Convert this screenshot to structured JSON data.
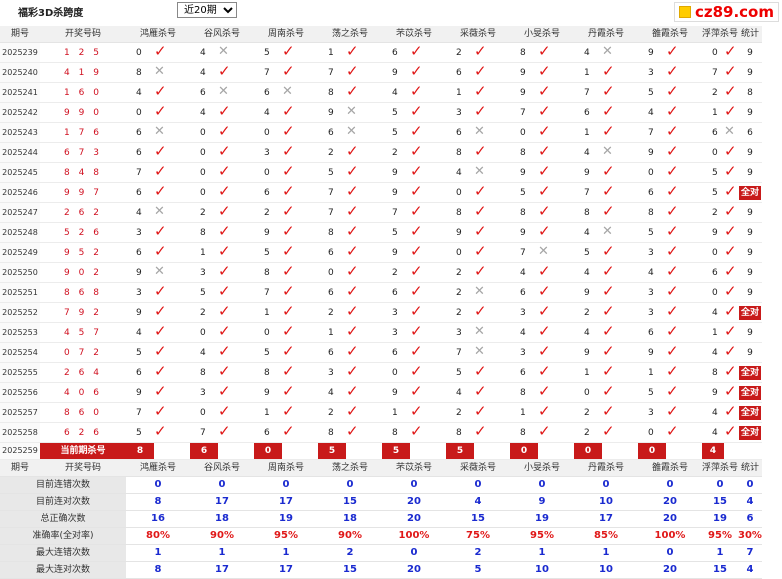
{
  "page": {
    "title": "福彩3D杀跨度",
    "period_select": "近20期",
    "logo_text": "cz89.com"
  },
  "columns": [
    "期号",
    "开奖号码",
    "鸿雁杀号",
    "谷风杀号",
    "周南杀号",
    "荡之杀号",
    "芣苡杀号",
    "采薇杀号",
    "小旻杀号",
    "丹霞杀号",
    "雒霞杀号",
    "浮萍杀号",
    "统计"
  ],
  "rows": [
    {
      "p": "2025239",
      "n": "125",
      "k": [
        [
          "0",
          1
        ],
        [
          "4",
          0
        ],
        [
          "5",
          1
        ],
        [
          "1",
          1
        ],
        [
          "6",
          1
        ],
        [
          "2",
          1
        ],
        [
          "8",
          1
        ],
        [
          "4",
          0
        ],
        [
          "9",
          1
        ],
        [
          "0",
          1
        ]
      ],
      "s": "9"
    },
    {
      "p": "2025240",
      "n": "419",
      "k": [
        [
          "8",
          0
        ],
        [
          "4",
          1
        ],
        [
          "7",
          1
        ],
        [
          "7",
          1
        ],
        [
          "9",
          1
        ],
        [
          "6",
          1
        ],
        [
          "9",
          1
        ],
        [
          "1",
          1
        ],
        [
          "3",
          1
        ],
        [
          "7",
          1
        ]
      ],
      "s": "9"
    },
    {
      "p": "2025241",
      "n": "160",
      "k": [
        [
          "4",
          1
        ],
        [
          "6",
          0
        ],
        [
          "6",
          0
        ],
        [
          "8",
          1
        ],
        [
          "4",
          1
        ],
        [
          "1",
          1
        ],
        [
          "9",
          1
        ],
        [
          "7",
          1
        ],
        [
          "5",
          1
        ],
        [
          "2",
          1
        ]
      ],
      "s": "8"
    },
    {
      "p": "2025242",
      "n": "990",
      "k": [
        [
          "0",
          1
        ],
        [
          "4",
          1
        ],
        [
          "4",
          1
        ],
        [
          "9",
          0
        ],
        [
          "5",
          1
        ],
        [
          "3",
          1
        ],
        [
          "7",
          1
        ],
        [
          "6",
          1
        ],
        [
          "4",
          1
        ],
        [
          "1",
          1
        ]
      ],
      "s": "9"
    },
    {
      "p": "2025243",
      "n": "176",
      "k": [
        [
          "6",
          0
        ],
        [
          "0",
          1
        ],
        [
          "0",
          1
        ],
        [
          "6",
          0
        ],
        [
          "5",
          1
        ],
        [
          "6",
          0
        ],
        [
          "0",
          1
        ],
        [
          "1",
          1
        ],
        [
          "7",
          1
        ],
        [
          "6",
          0
        ]
      ],
      "s": "6"
    },
    {
      "p": "2025244",
      "n": "673",
      "k": [
        [
          "6",
          1
        ],
        [
          "0",
          1
        ],
        [
          "3",
          1
        ],
        [
          "2",
          1
        ],
        [
          "2",
          1
        ],
        [
          "8",
          1
        ],
        [
          "8",
          1
        ],
        [
          "4",
          0
        ],
        [
          "9",
          1
        ],
        [
          "0",
          1
        ]
      ],
      "s": "9"
    },
    {
      "p": "2025245",
      "n": "848",
      "k": [
        [
          "7",
          1
        ],
        [
          "0",
          1
        ],
        [
          "0",
          1
        ],
        [
          "5",
          1
        ],
        [
          "9",
          1
        ],
        [
          "4",
          0
        ],
        [
          "9",
          1
        ],
        [
          "9",
          1
        ],
        [
          "0",
          1
        ],
        [
          "5",
          1
        ]
      ],
      "s": "9"
    },
    {
      "p": "2025246",
      "n": "997",
      "k": [
        [
          "6",
          1
        ],
        [
          "0",
          1
        ],
        [
          "6",
          1
        ],
        [
          "7",
          1
        ],
        [
          "9",
          1
        ],
        [
          "0",
          1
        ],
        [
          "5",
          1
        ],
        [
          "7",
          1
        ],
        [
          "6",
          1
        ],
        [
          "5",
          1
        ]
      ],
      "s": "全对"
    },
    {
      "p": "2025247",
      "n": "262",
      "k": [
        [
          "4",
          0
        ],
        [
          "2",
          1
        ],
        [
          "2",
          1
        ],
        [
          "7",
          1
        ],
        [
          "7",
          1
        ],
        [
          "8",
          1
        ],
        [
          "8",
          1
        ],
        [
          "8",
          1
        ],
        [
          "8",
          1
        ],
        [
          "2",
          1
        ]
      ],
      "s": "9"
    },
    {
      "p": "2025248",
      "n": "526",
      "k": [
        [
          "3",
          1
        ],
        [
          "8",
          1
        ],
        [
          "9",
          1
        ],
        [
          "8",
          1
        ],
        [
          "5",
          1
        ],
        [
          "9",
          1
        ],
        [
          "9",
          1
        ],
        [
          "4",
          0
        ],
        [
          "5",
          1
        ],
        [
          "9",
          1
        ]
      ],
      "s": "9"
    },
    {
      "p": "2025249",
      "n": "952",
      "k": [
        [
          "6",
          1
        ],
        [
          "1",
          1
        ],
        [
          "5",
          1
        ],
        [
          "6",
          1
        ],
        [
          "9",
          1
        ],
        [
          "0",
          1
        ],
        [
          "7",
          0
        ],
        [
          "5",
          1
        ],
        [
          "3",
          1
        ],
        [
          "0",
          1
        ]
      ],
      "s": "9"
    },
    {
      "p": "2025250",
      "n": "902",
      "k": [
        [
          "9",
          0
        ],
        [
          "3",
          1
        ],
        [
          "8",
          1
        ],
        [
          "0",
          1
        ],
        [
          "2",
          1
        ],
        [
          "2",
          1
        ],
        [
          "4",
          1
        ],
        [
          "4",
          1
        ],
        [
          "4",
          1
        ],
        [
          "6",
          1
        ]
      ],
      "s": "9"
    },
    {
      "p": "2025251",
      "n": "868",
      "k": [
        [
          "3",
          1
        ],
        [
          "5",
          1
        ],
        [
          "7",
          1
        ],
        [
          "6",
          1
        ],
        [
          "6",
          1
        ],
        [
          "2",
          0
        ],
        [
          "6",
          1
        ],
        [
          "9",
          1
        ],
        [
          "3",
          1
        ],
        [
          "0",
          1
        ]
      ],
      "s": "9"
    },
    {
      "p": "2025252",
      "n": "792",
      "k": [
        [
          "9",
          1
        ],
        [
          "2",
          1
        ],
        [
          "1",
          1
        ],
        [
          "2",
          1
        ],
        [
          "3",
          1
        ],
        [
          "2",
          1
        ],
        [
          "3",
          1
        ],
        [
          "2",
          1
        ],
        [
          "3",
          1
        ],
        [
          "4",
          1
        ]
      ],
      "s": "全对"
    },
    {
      "p": "2025253",
      "n": "457",
      "k": [
        [
          "4",
          1
        ],
        [
          "0",
          1
        ],
        [
          "0",
          1
        ],
        [
          "1",
          1
        ],
        [
          "3",
          1
        ],
        [
          "3",
          0
        ],
        [
          "4",
          1
        ],
        [
          "4",
          1
        ],
        [
          "6",
          1
        ],
        [
          "1",
          1
        ]
      ],
      "s": "9"
    },
    {
      "p": "2025254",
      "n": "072",
      "k": [
        [
          "5",
          1
        ],
        [
          "4",
          1
        ],
        [
          "5",
          1
        ],
        [
          "6",
          1
        ],
        [
          "6",
          1
        ],
        [
          "7",
          0
        ],
        [
          "3",
          1
        ],
        [
          "9",
          1
        ],
        [
          "9",
          1
        ],
        [
          "4",
          1
        ]
      ],
      "s": "9"
    },
    {
      "p": "2025255",
      "n": "264",
      "k": [
        [
          "6",
          1
        ],
        [
          "8",
          1
        ],
        [
          "8",
          1
        ],
        [
          "3",
          1
        ],
        [
          "0",
          1
        ],
        [
          "5",
          1
        ],
        [
          "6",
          1
        ],
        [
          "1",
          1
        ],
        [
          "1",
          1
        ],
        [
          "8",
          1
        ]
      ],
      "s": "全对"
    },
    {
      "p": "2025256",
      "n": "406",
      "k": [
        [
          "9",
          1
        ],
        [
          "3",
          1
        ],
        [
          "9",
          1
        ],
        [
          "4",
          1
        ],
        [
          "9",
          1
        ],
        [
          "4",
          1
        ],
        [
          "8",
          1
        ],
        [
          "0",
          1
        ],
        [
          "5",
          1
        ],
        [
          "9",
          1
        ]
      ],
      "s": "全对"
    },
    {
      "p": "2025257",
      "n": "860",
      "k": [
        [
          "7",
          1
        ],
        [
          "0",
          1
        ],
        [
          "1",
          1
        ],
        [
          "2",
          1
        ],
        [
          "1",
          1
        ],
        [
          "2",
          1
        ],
        [
          "1",
          1
        ],
        [
          "2",
          1
        ],
        [
          "3",
          1
        ],
        [
          "4",
          1
        ]
      ],
      "s": "全对"
    },
    {
      "p": "2025258",
      "n": "626",
      "k": [
        [
          "5",
          1
        ],
        [
          "7",
          1
        ],
        [
          "6",
          1
        ],
        [
          "8",
          1
        ],
        [
          "8",
          1
        ],
        [
          "8",
          1
        ],
        [
          "8",
          1
        ],
        [
          "2",
          1
        ],
        [
          "0",
          1
        ],
        [
          "4",
          1
        ]
      ],
      "s": "全对"
    }
  ],
  "current": {
    "p": "2025259",
    "label": "当前期杀号",
    "k": [
      "8",
      "6",
      "0",
      "5",
      "5",
      "5",
      "0",
      "0",
      "0",
      "4"
    ]
  },
  "stats": [
    {
      "label": "目前连错次数",
      "v": [
        "0",
        "0",
        "0",
        "0",
        "0",
        "0",
        "0",
        "0",
        "0",
        "0",
        "0"
      ],
      "red": false
    },
    {
      "label": "目前连对次数",
      "v": [
        "8",
        "17",
        "17",
        "15",
        "20",
        "4",
        "9",
        "10",
        "20",
        "15",
        "4"
      ],
      "red": false
    },
    {
      "label": "总正确次数",
      "v": [
        "16",
        "18",
        "19",
        "18",
        "20",
        "15",
        "19",
        "17",
        "20",
        "19",
        "6"
      ],
      "red": false
    },
    {
      "label": "准确率(全对率)",
      "v": [
        "80%",
        "90%",
        "95%",
        "90%",
        "100%",
        "75%",
        "95%",
        "85%",
        "100%",
        "95%",
        "30%"
      ],
      "red": true
    },
    {
      "label": "最大连错次数",
      "v": [
        "1",
        "1",
        "1",
        "2",
        "0",
        "2",
        "1",
        "1",
        "0",
        "1",
        "7"
      ],
      "red": false
    },
    {
      "label": "最大连对次数",
      "v": [
        "8",
        "17",
        "17",
        "15",
        "20",
        "5",
        "10",
        "10",
        "20",
        "15",
        "4"
      ],
      "red": false
    }
  ],
  "colors": {
    "accent_red": "#c81a1a",
    "check_red": "#e01818",
    "stat_blue": "#1a2ad0",
    "cross_gray": "#a6a6a6"
  }
}
